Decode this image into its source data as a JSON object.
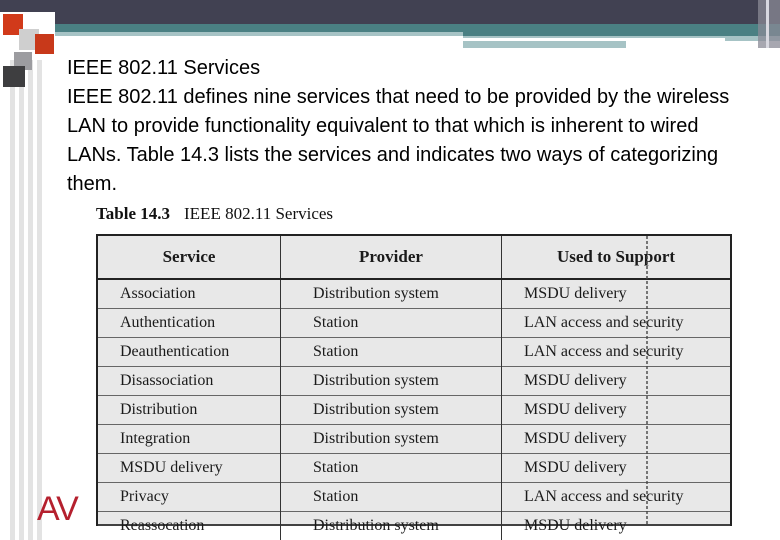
{
  "slide": {
    "title": "IEEE 802.11 Services",
    "paragraph": "IEEE 802.11 defines nine services that need to be provided by the wireless LAN to provide functionality equivalent to that which is inherent to wired LANs. Table 14.3 lists the services and indicates two ways of categorizing them.",
    "logo_text": "AV"
  },
  "table": {
    "caption_number": "Table 14.3",
    "caption_title": "IEEE 802.11 Services",
    "headers": [
      "Service",
      "Provider",
      "Used to Support"
    ],
    "rows": [
      [
        "Association",
        "Distribution system",
        "MSDU delivery"
      ],
      [
        "Authentication",
        "Station",
        "LAN access and security"
      ],
      [
        "Deauthentication",
        "Station",
        "LAN access and security"
      ],
      [
        "Disassociation",
        "Distribution system",
        "MSDU delivery"
      ],
      [
        "Distribution",
        "Distribution system",
        "MSDU delivery"
      ],
      [
        "Integration",
        "Distribution system",
        "MSDU delivery"
      ],
      [
        "MSDU delivery",
        "Station",
        "MSDU delivery"
      ],
      [
        "Privacy",
        "Station",
        "LAN access and security"
      ],
      [
        "Reassocation",
        "Distribution system",
        "MSDU delivery"
      ]
    ]
  },
  "colors": {
    "header_bar": "#414152",
    "teal_band": "#4a8083",
    "accent_red": "#d13a1a",
    "logo_red": "#b5202e"
  }
}
